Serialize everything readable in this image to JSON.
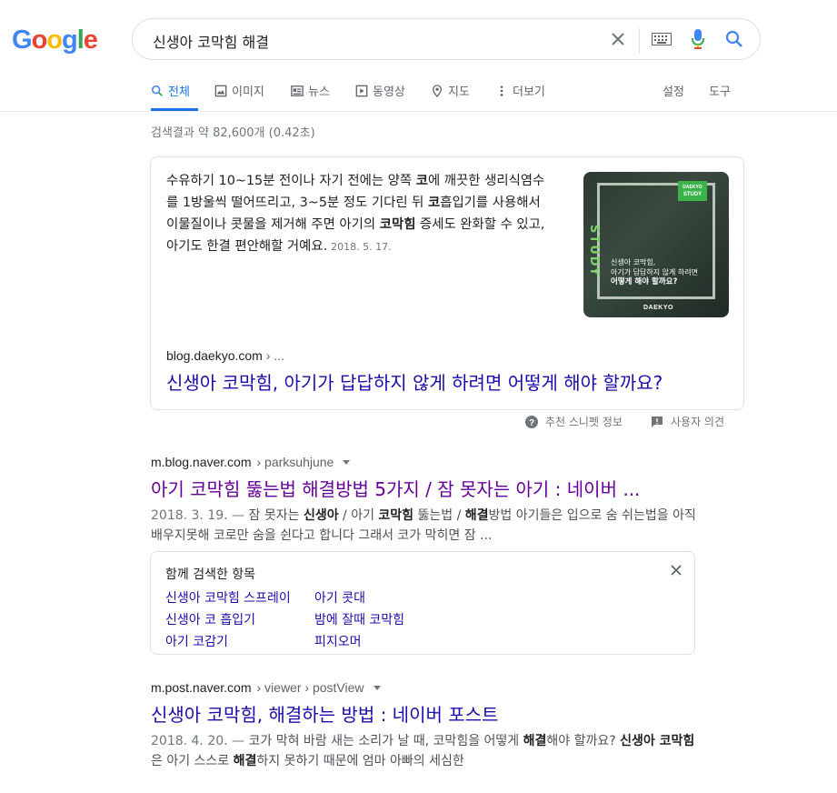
{
  "logo": {
    "letters": [
      "G",
      "o",
      "o",
      "g",
      "l",
      "e"
    ],
    "colors": [
      "#4285f4",
      "#ea4335",
      "#fbbc05",
      "#4285f4",
      "#34a853",
      "#ea4335"
    ]
  },
  "search": {
    "query": "신생아 코막힘 해결"
  },
  "tabs": [
    {
      "label": "전체",
      "icon": "search-icon",
      "active": true
    },
    {
      "label": "이미지",
      "icon": "image-icon"
    },
    {
      "label": "뉴스",
      "icon": "news-icon"
    },
    {
      "label": "동영상",
      "icon": "video-icon"
    },
    {
      "label": "지도",
      "icon": "map-pin-icon"
    },
    {
      "label": "더보기",
      "icon": "more-vert-icon"
    }
  ],
  "tools": {
    "settings": "설정",
    "tools": "도구"
  },
  "results_count": "검색결과 약 82,600개 (0.42초)",
  "snippet": {
    "text_parts": [
      {
        "t": "수유하기 10~15분 전이나 자기 전에는 양쪽 "
      },
      {
        "t": "코",
        "b": true
      },
      {
        "t": "에 깨끗한 생리식염수를 1방울씩 떨어뜨리고, 3~5분 정도 기다린 뒤 "
      },
      {
        "t": "코",
        "b": true
      },
      {
        "t": "흡입기를 사용해서 이물질이나 콧물을 제거해 주면 아기의 "
      },
      {
        "t": "코막힘",
        "b": true
      },
      {
        "t": " 증세도 완화할 수 있고, 아기도 한결 편안해할 거예요."
      }
    ],
    "date": "2018. 5. 17.",
    "thumb": {
      "badge_top": "DAEKYO",
      "badge_bottom": "STUDY",
      "side_text": "STUDY",
      "caption_line1": "신생아 코막힘,",
      "caption_line2": "아기가 답답하지 않게 하려면",
      "caption_line3": "어떻게 해야 할까요?",
      "logo": "DAEKYO"
    },
    "cite_domain": "blog.daekyo.com",
    "cite_path": "› ...",
    "title": "신생아 코막힘, 아기가 답답하지 않게 하려면 어떻게 해야 할까요?",
    "footer_about": "추천 스니펫 정보",
    "footer_feedback": "사용자 의견"
  },
  "results": [
    {
      "cite_domain": "m.blog.naver.com",
      "cite_path": "› parksuhjune",
      "title": "아기 코막힘 뚫는법 해결방법 5가지 / 잠 못자는 아기 : 네이버 ...",
      "date": "2018. 3. 19. —",
      "desc_parts": [
        {
          "t": " 잠 못자는 "
        },
        {
          "t": "신생아",
          "b": true
        },
        {
          "t": " / 아기 "
        },
        {
          "t": "코막힘",
          "b": true
        },
        {
          "t": " 뚫는법 / "
        },
        {
          "t": "해결",
          "b": true
        },
        {
          "t": "방법 아기들은 입으로 숨 쉬는법을 아직 배우지못해 코로만 숨을 쉰다고 합니다 그래서 코가 막히면 잠 ..."
        }
      ]
    },
    {
      "cite_domain": "m.post.naver.com",
      "cite_path": "› viewer › postView",
      "title": "신생아 코막힘, 해결하는 방법 : 네이버 포스트",
      "date": "2018. 4. 20. —",
      "desc_parts": [
        {
          "t": " 코가 막혀 바람 새는 소리가 날 때, 코막힘을 어떻게 "
        },
        {
          "t": "해결",
          "b": true
        },
        {
          "t": "해야 할까요? "
        },
        {
          "t": "신생아 코막힘",
          "b": true
        },
        {
          "t": "은 아기 스스로 "
        },
        {
          "t": "해결",
          "b": true
        },
        {
          "t": "하지 못하기 때문에 엄마 아빠의 세심한"
        }
      ]
    }
  ],
  "related": {
    "title": "함께 검색한 항목",
    "items": [
      "신생아 코막힘 스프레이",
      "아기 콧대",
      "신생아 코 흡입기",
      "밤에 잘때 코막힘",
      "아기 코감기",
      "피지오머"
    ]
  }
}
